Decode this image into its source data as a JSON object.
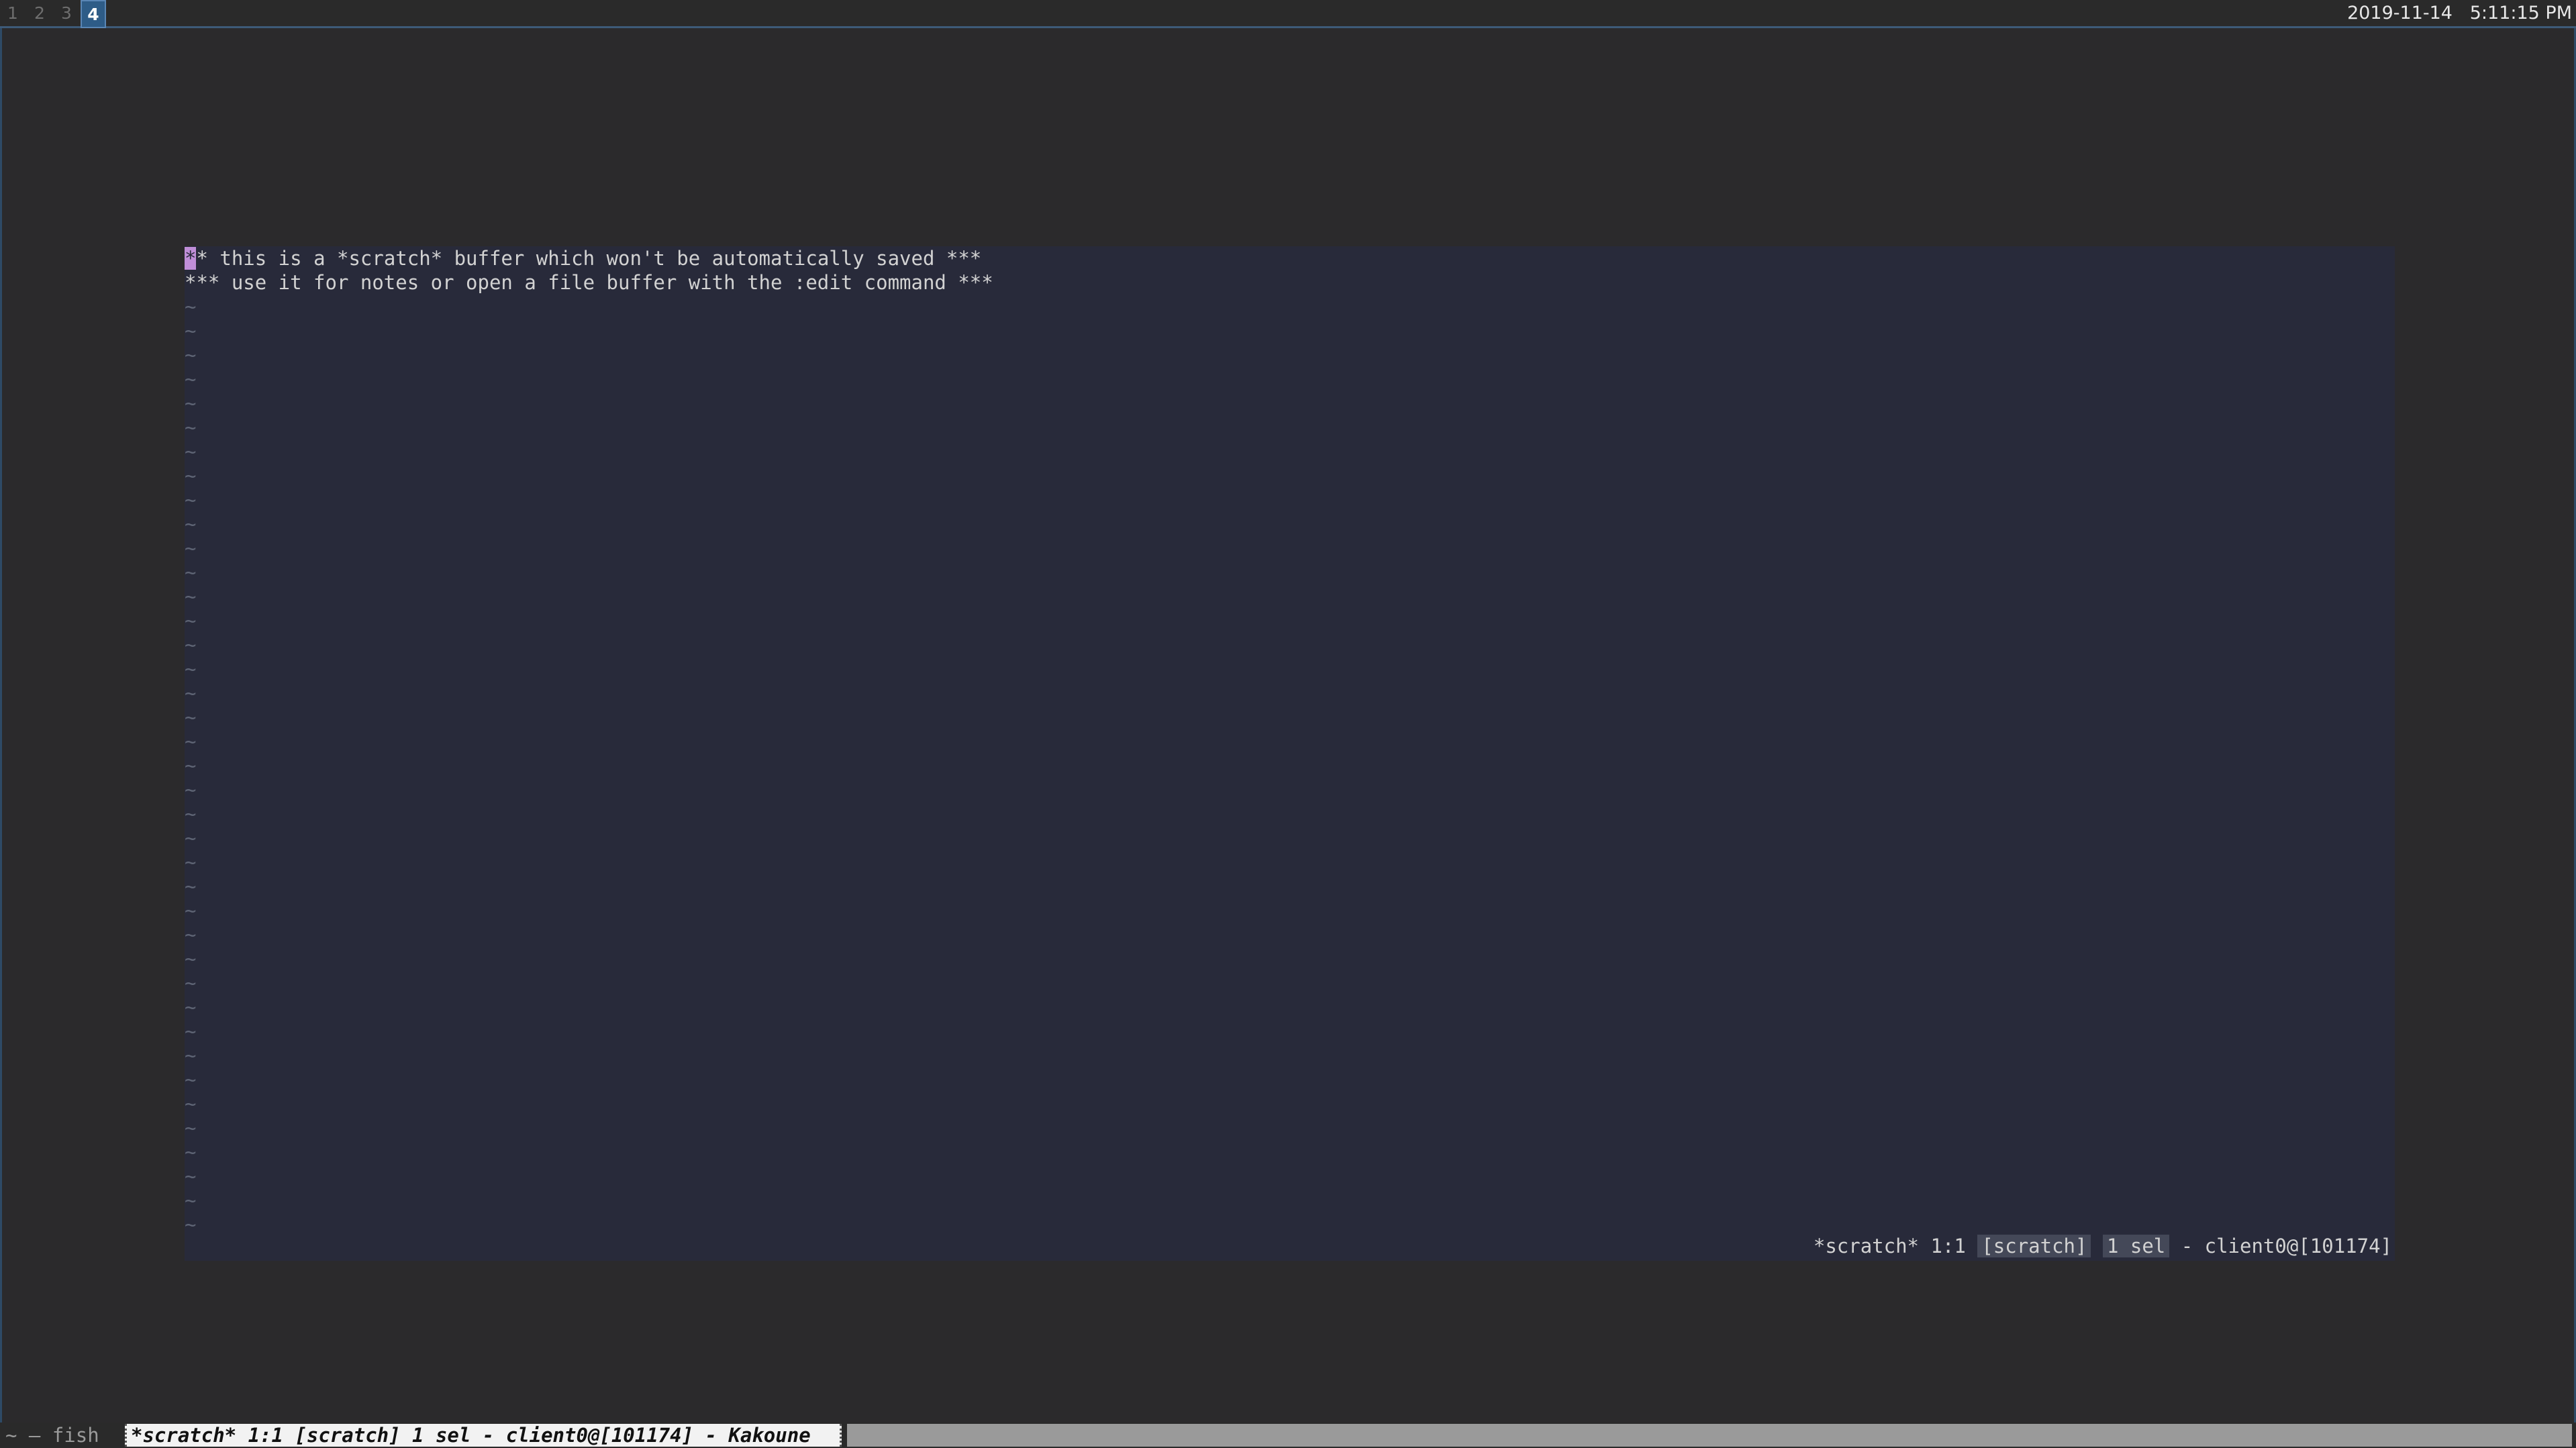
{
  "topbar": {
    "workspaces": [
      {
        "label": "1",
        "active": false
      },
      {
        "label": "2",
        "active": false
      },
      {
        "label": "3",
        "active": false
      },
      {
        "label": "4",
        "active": true
      }
    ],
    "date": "2019-11-14",
    "time": "5:11:15 PM"
  },
  "editor": {
    "cursor_char": "*",
    "line1_rest": "* this is a *scratch* buffer which won't be automatically saved ***",
    "line2": "*** use it for notes or open a file buffer with the :edit command ***",
    "tilde": "~",
    "modeline": {
      "buffer": "*scratch*",
      "position": "1:1",
      "buffer_kind": "[scratch]",
      "selections": "1 sel",
      "client": "- client0@[101174]"
    }
  },
  "taskbar": {
    "fish_tab": "~ — fish",
    "kakoune_tab": "*scratch* 1:1 [scratch] 1 sel - client0@[101174] - Kakoune"
  },
  "colors": {
    "editor_bg": "#282a3a",
    "cursor": "#c08ed8",
    "active_workspace": "#2e5c87"
  }
}
